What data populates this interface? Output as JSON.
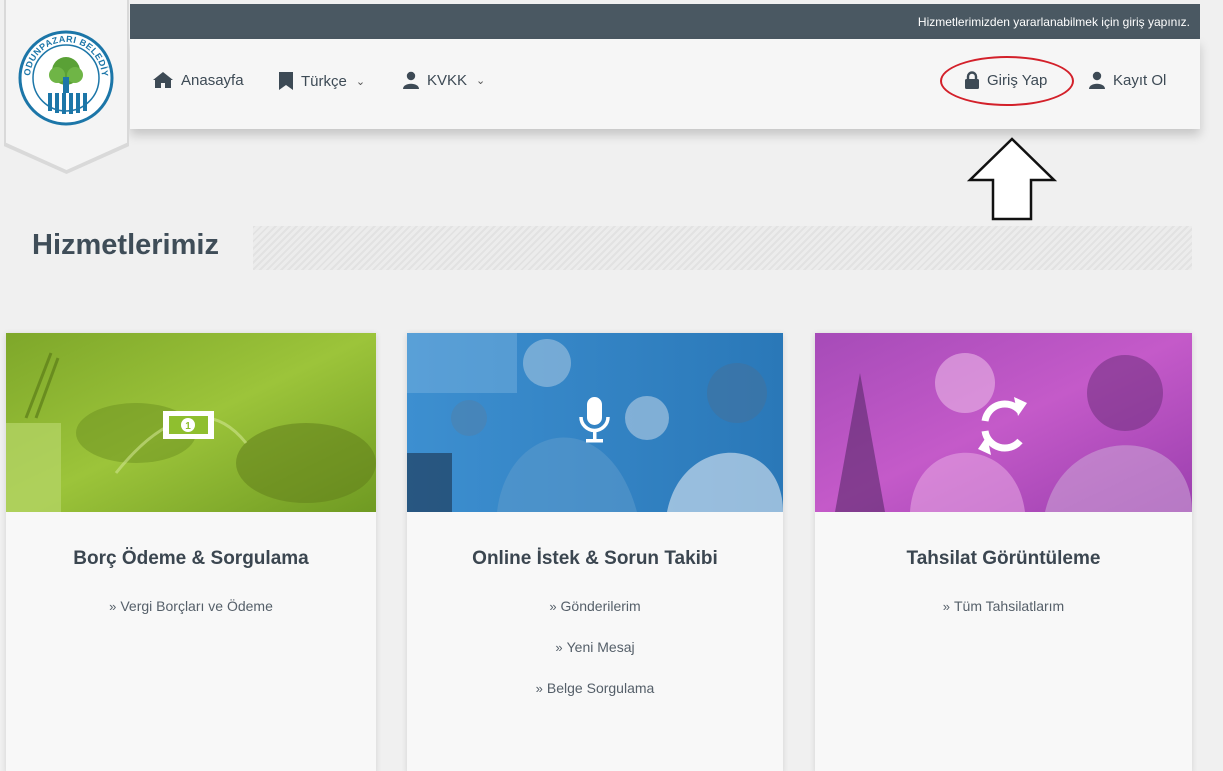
{
  "topbar": {
    "message": "Hizmetlerimizden yararlanabilmek için giriş yapınız."
  },
  "logo": {
    "name": "ODUNPAZARI BELEDİYESİ",
    "colors": {
      "ring": "#1c76a8",
      "tree": "#5aa136"
    }
  },
  "nav": {
    "home": {
      "label": "Anasayfa",
      "icon": "home-icon"
    },
    "language": {
      "label": "Türkçe",
      "icon": "bookmark-icon"
    },
    "kvkk": {
      "label": "KVKK",
      "icon": "user-icon"
    },
    "login": {
      "label": "Giriş Yap",
      "icon": "lock-icon"
    },
    "register": {
      "label": "Kayıt Ol",
      "icon": "user-icon"
    }
  },
  "section": {
    "title": "Hizmetlerimiz"
  },
  "cards": [
    {
      "title": "Borç Ödeme & Sorgulama",
      "icon": "money-bill-icon",
      "color": "#8fbf2f",
      "links": [
        {
          "label": "Vergi Borçları ve Ödeme"
        }
      ]
    },
    {
      "title": "Online İstek & Sorun Takibi",
      "icon": "microphone-icon",
      "color": "#2a8fd0",
      "links": [
        {
          "label": "Gönderilerim"
        },
        {
          "label": "Yeni Mesaj"
        },
        {
          "label": "Belge Sorgulama"
        }
      ]
    },
    {
      "title": "Tahsilat Görüntüleme",
      "icon": "refresh-icon",
      "color": "#b84fc4",
      "links": [
        {
          "label": "Tüm Tahsilatlarım"
        }
      ]
    }
  ],
  "colors": {
    "topbar": "#4a5862",
    "annotation": "#d3202a",
    "heading": "#3f4d58"
  }
}
